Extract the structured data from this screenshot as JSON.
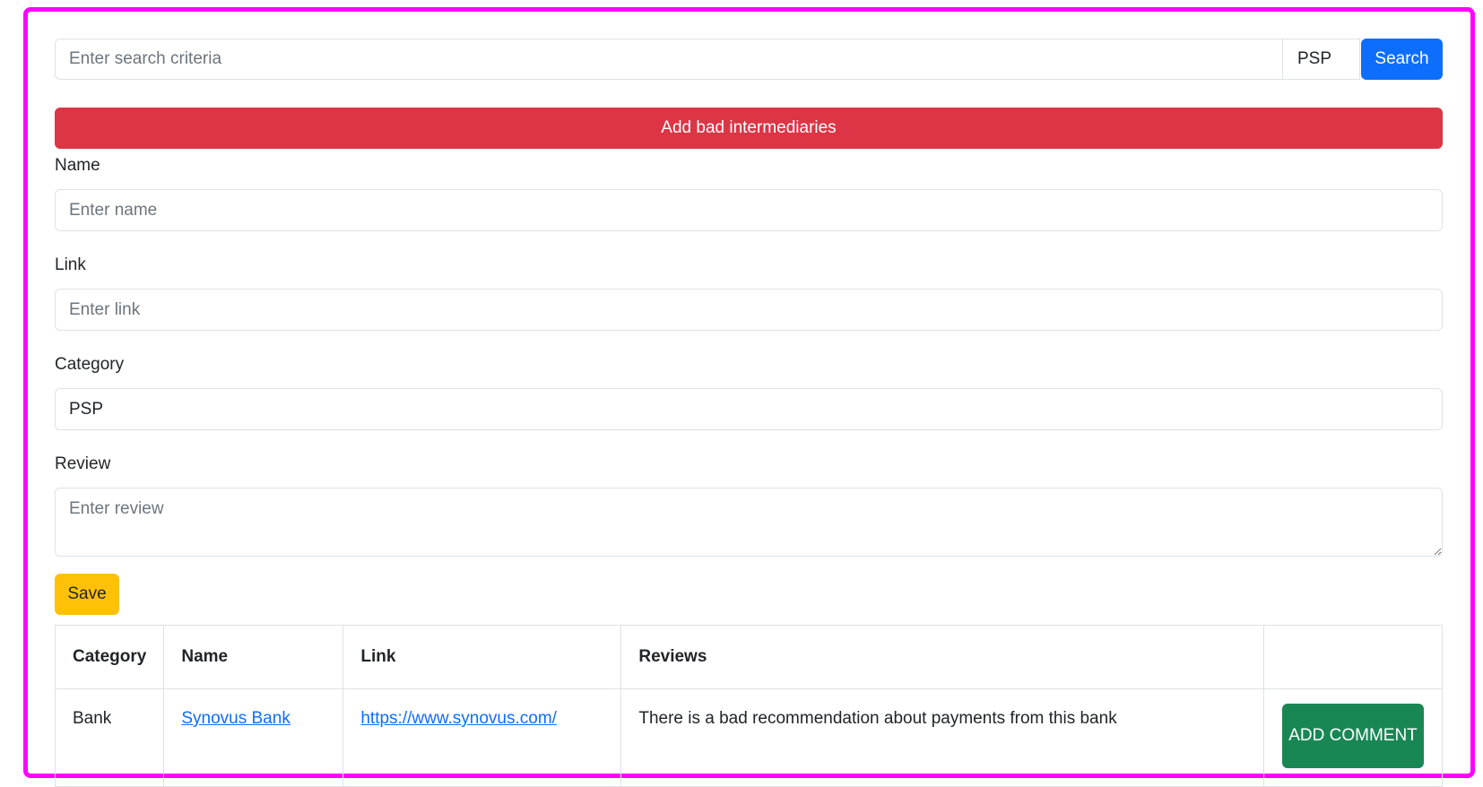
{
  "search": {
    "placeholder": "Enter search criteria",
    "category_value": "PSP",
    "button_label": "Search"
  },
  "add_bar": {
    "label": "Add bad intermediaries"
  },
  "form": {
    "name_label": "Name",
    "name_placeholder": "Enter name",
    "link_label": "Link",
    "link_placeholder": "Enter link",
    "category_label": "Category",
    "category_value": "PSP",
    "review_label": "Review",
    "review_placeholder": "Enter review",
    "save_label": "Save"
  },
  "table": {
    "headers": [
      "Category",
      "Name",
      "Link",
      "Reviews",
      ""
    ],
    "rows": [
      {
        "category": "Bank",
        "name": "Synovus Bank",
        "link": "https://www.synovus.com/",
        "review": "There is a bad recommendation about payments from this bank",
        "action": "ADD COMMENT"
      }
    ]
  },
  "colors": {
    "frame": "#ff00ff",
    "primary": "#0d6efd",
    "danger": "#dc3545",
    "warning": "#ffc107",
    "success": "#198754"
  }
}
